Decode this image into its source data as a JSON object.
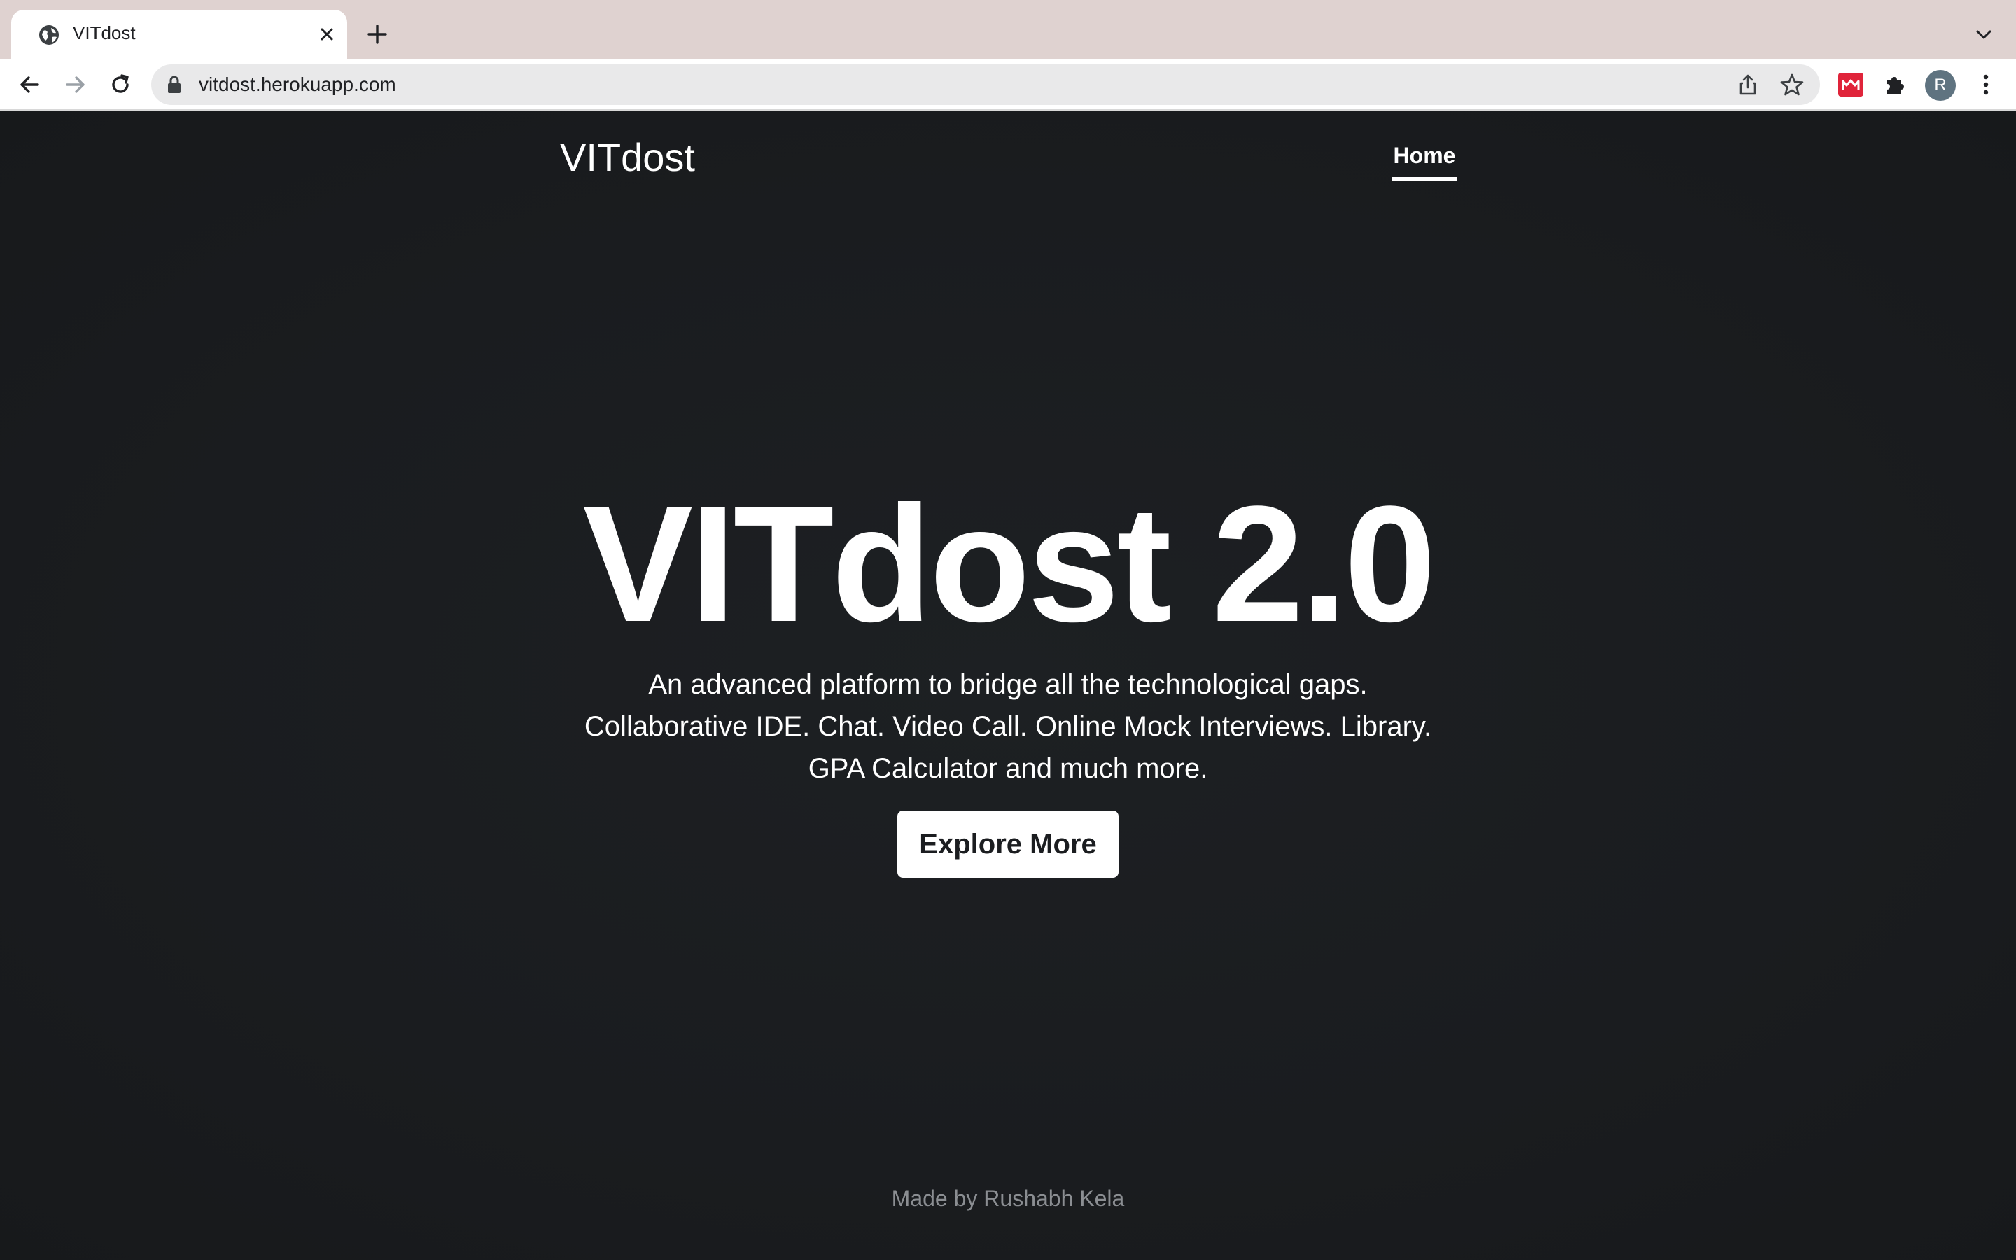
{
  "browser": {
    "tab_title": "VITdost",
    "url": "vitdost.herokuapp.com",
    "profile_initial": "R",
    "icons": [
      "globe-icon",
      "close-icon",
      "plus-icon",
      "chevron-down-icon",
      "back-arrow-icon",
      "forward-arrow-icon",
      "reload-icon",
      "lock-icon",
      "share-icon",
      "star-icon",
      "extension-icon",
      "puzzle-icon",
      "menu-dots-icon"
    ]
  },
  "site": {
    "brand": "VITdost",
    "nav": {
      "home": "Home"
    },
    "hero": {
      "title": "VITdost 2.0",
      "lead_line1": "An advanced platform to bridge all the technological gaps.",
      "lead_line2": "Collaborative IDE. Chat. Video Call. Online Mock Interviews. Library.",
      "lead_line3": "GPA Calculator and much more.",
      "cta": "Explore More"
    },
    "footer": "Made by Rushabh Kela"
  },
  "colors": {
    "page_background": "#1b1d20",
    "text": "#ffffff",
    "footer_text": "#8b8e92",
    "tabstrip": "#dfd2d0"
  }
}
